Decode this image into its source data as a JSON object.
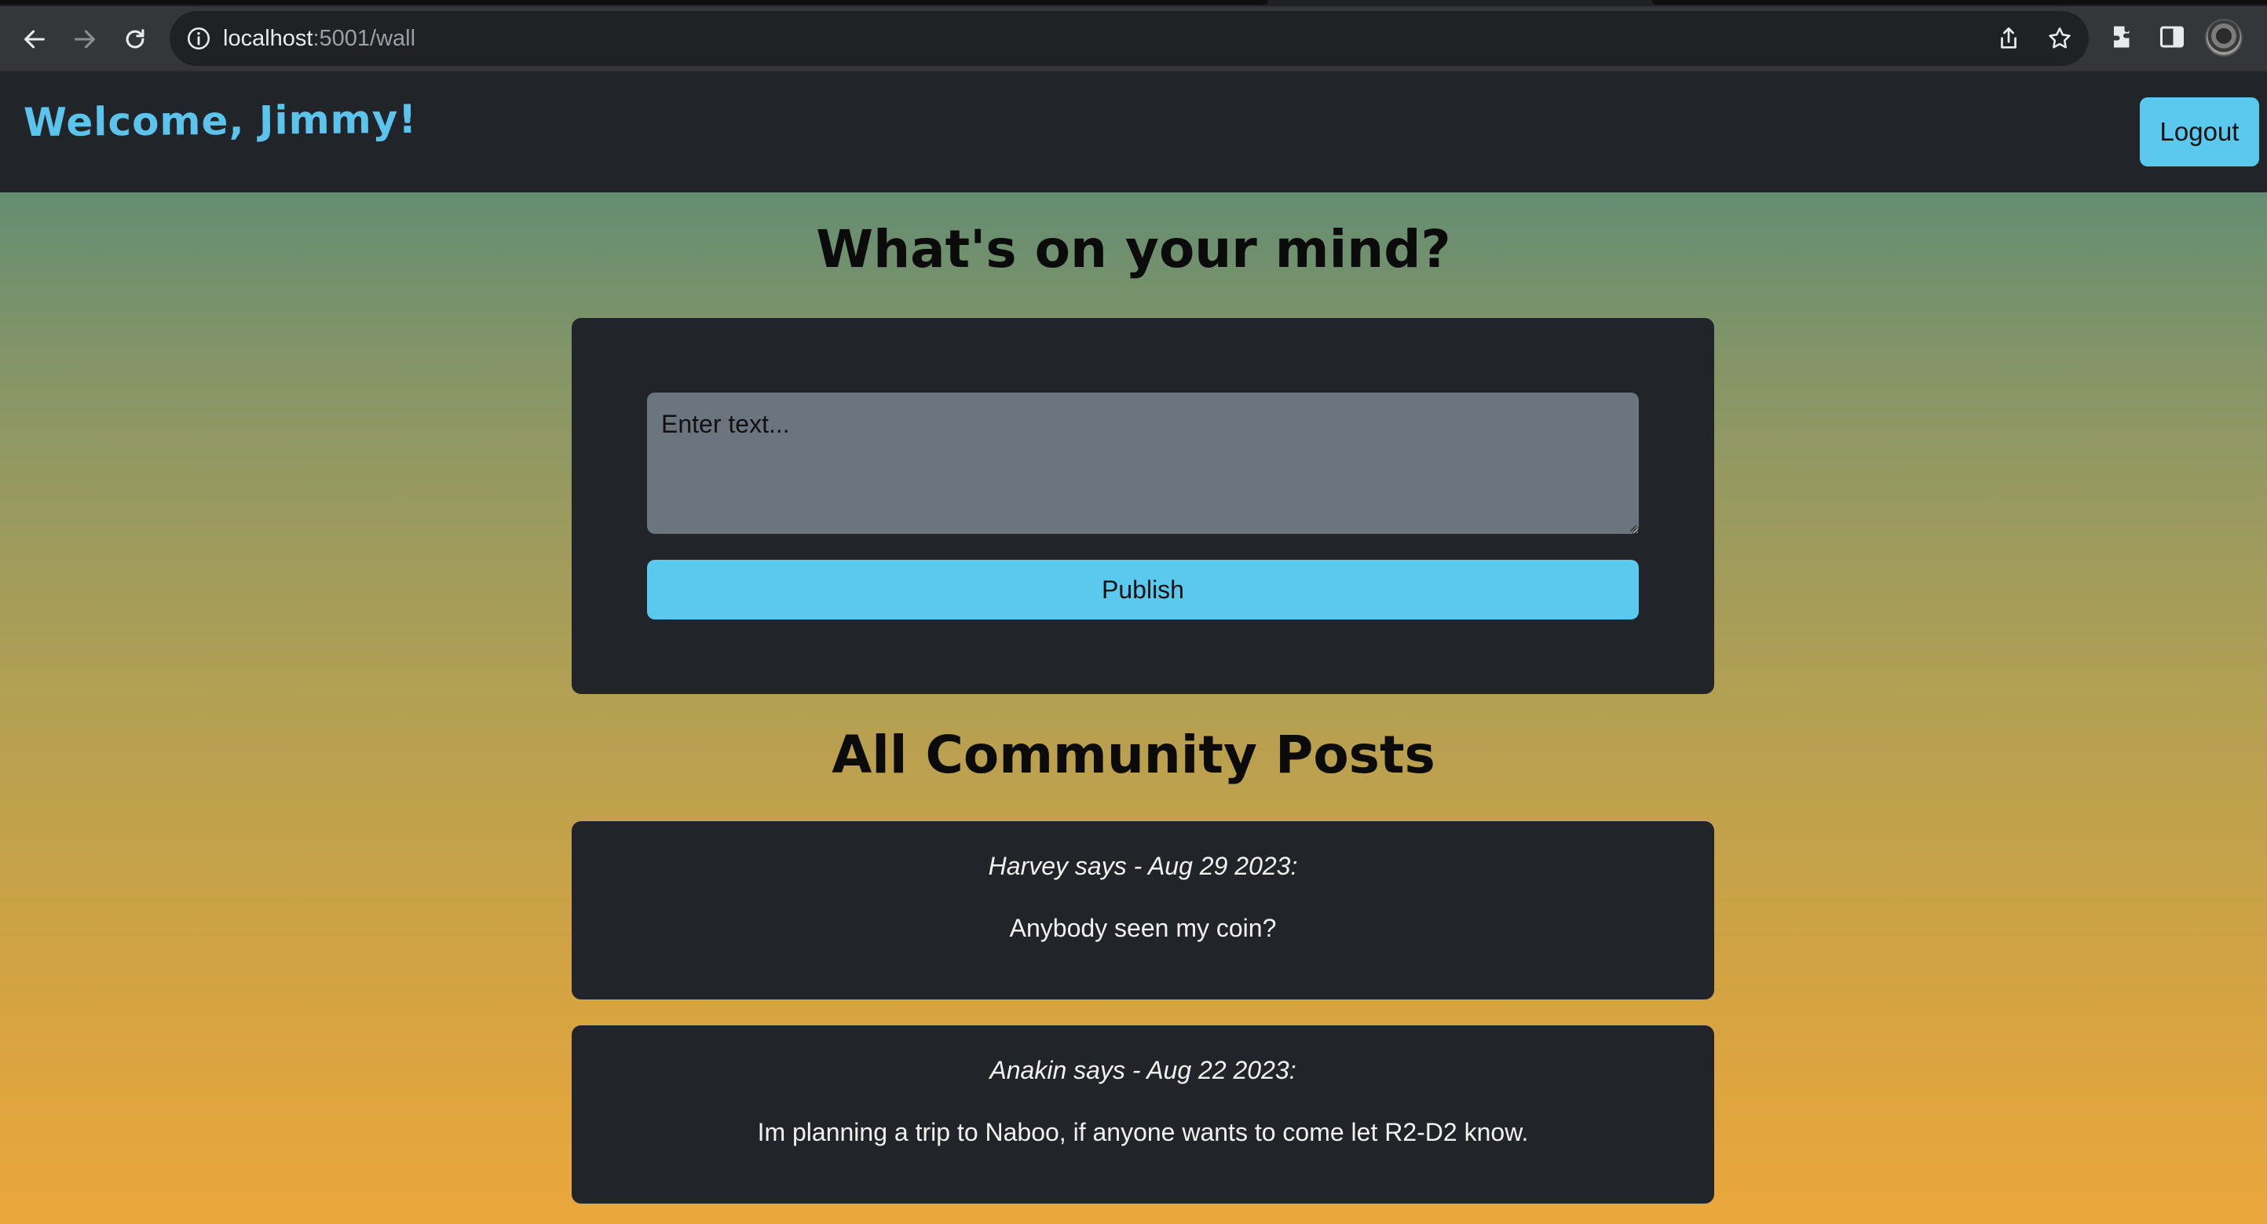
{
  "browser": {
    "url_host": "localhost",
    "url_path": ":5001/wall"
  },
  "header": {
    "welcome": "Welcome, Jimmy!",
    "logout_label": "Logout"
  },
  "compose": {
    "title": "What's on your mind?",
    "placeholder": "Enter text...",
    "publish_label": "Publish"
  },
  "feed": {
    "title": "All Community Posts",
    "posts": [
      {
        "meta": "Harvey says - Aug 29 2023:",
        "body": "Anybody seen my coin?"
      },
      {
        "meta": "Anakin says - Aug 22 2023:",
        "body": "Im planning a trip to Naboo, if anyone wants to come let R2-D2 know."
      }
    ]
  },
  "colors": {
    "accent": "#5bc8ee",
    "card_bg": "#212529",
    "input_bg": "#6c757d"
  }
}
